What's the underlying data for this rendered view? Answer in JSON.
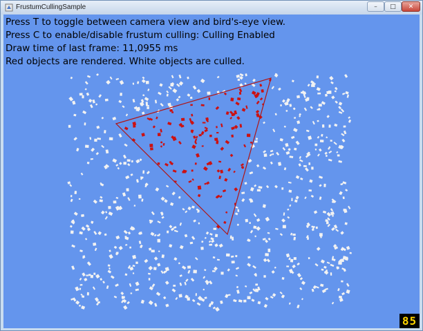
{
  "window": {
    "title": "FrustumCullingSample"
  },
  "controls": {
    "minimize": "–",
    "maximize": "□",
    "close": "✕"
  },
  "info_lines": [
    "Press T to toggle between camera view and bird's-eye view.",
    "Press C to enable/disable frustum culling:  Culling Enabled",
    "Draw time of last frame: 11,0955 ms",
    "Red objects are rendered. White objects are culled."
  ],
  "fps": "85",
  "colors": {
    "background": "#6495ed",
    "rendered_object": "#cc1111",
    "culled_object": "#f2f2f2",
    "frustum_outline": "#b01515",
    "fps_text": "#ffd400"
  }
}
